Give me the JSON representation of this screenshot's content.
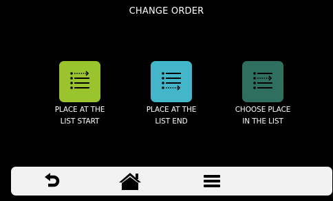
{
  "header": {
    "title": "CHANGE ORDER"
  },
  "options": [
    {
      "label": "PLACE AT THE\nLIST START",
      "color": "#9ac42e",
      "icon": "list-insert-start-icon"
    },
    {
      "label": "PLACE AT THE\nLIST END",
      "color": "#43b7c9",
      "icon": "list-insert-end-icon"
    },
    {
      "label": "CHOOSE PLACE\nIN THE LIST",
      "color": "#2f6f5f",
      "icon": "list-insert-middle-icon"
    }
  ],
  "bottom_bar": {
    "items": [
      {
        "icon": "back-arrow-icon"
      },
      {
        "icon": "home-icon"
      },
      {
        "icon": "menu-icon"
      }
    ]
  }
}
